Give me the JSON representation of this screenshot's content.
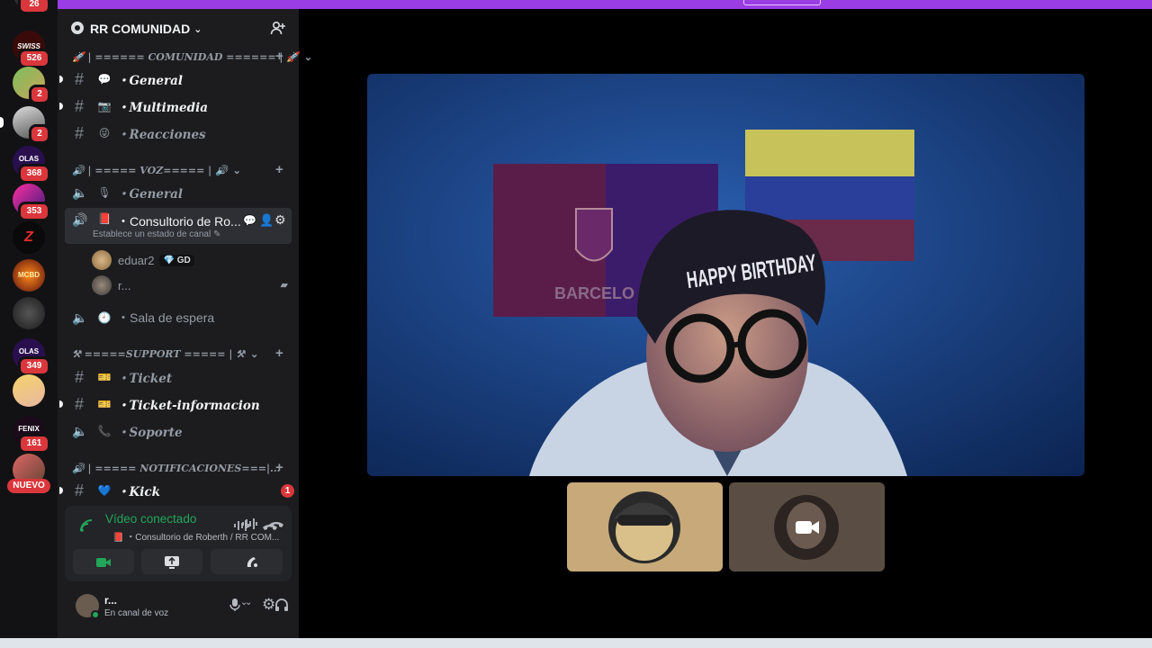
{
  "rail": {
    "top_badge": "26",
    "servers": [
      {
        "label": "SWISS",
        "badge": "526"
      },
      {
        "label": "",
        "badge": "2"
      },
      {
        "label": "",
        "badge": "2"
      },
      {
        "label": "OLAS",
        "badge": "368"
      },
      {
        "label": "",
        "badge": "353"
      },
      {
        "label": "Z",
        "badge": ""
      },
      {
        "label": "MCBD",
        "badge": ""
      },
      {
        "label": "",
        "badge": ""
      },
      {
        "label": "OLAS",
        "badge": "349"
      },
      {
        "label": "",
        "badge": ""
      },
      {
        "label": "FENIX",
        "badge": "161"
      }
    ],
    "new_label": "NUEVO"
  },
  "guild": {
    "name": "RR COMUNIDAD"
  },
  "categories": {
    "comunidad": "🚀 | ====== COMUNIDAD ====== | 🚀",
    "voz": "🔊 | ===== VOZ===== | 🔊",
    "support": "⚒ =====SUPPORT ===== | ⚒",
    "notificaciones": "🔊 | ===== NOTIFICACIONES===|..."
  },
  "channels": {
    "general": {
      "emoji": "💬",
      "name": "・General"
    },
    "multimedia": {
      "emoji": "📷",
      "name": "・Multimedia"
    },
    "reacciones": {
      "emoji": "😜",
      "name": "・Reacciones"
    },
    "voz_general": {
      "emoji": "🎙",
      "name": "・General"
    },
    "consultorio": {
      "emoji": "📕",
      "name": "・Consultorio de Ro...",
      "status_hint": "Establece un estado de canal ✎"
    },
    "sala": {
      "emoji": "🕘",
      "name": "・Sala de espera"
    },
    "ticket": {
      "emoji": "🎫",
      "name": "・Ticket"
    },
    "ticket_info": {
      "emoji": "🎫",
      "name": "・Ticket-informacion"
    },
    "soporte": {
      "emoji": "📞",
      "name": "・Soporte"
    },
    "kick": {
      "emoji": "💙",
      "name": "・Kick",
      "mentions": "1"
    }
  },
  "voice_users": [
    {
      "name": "eduar2",
      "tag": "💎 GD"
    },
    {
      "name": "r...",
      "tag": ""
    }
  ],
  "voice_panel": {
    "title": "Vídeo conectado",
    "subtitle": "📕 ・Consultorio de Roberth / RR COM..."
  },
  "user_panel": {
    "name": "r...",
    "status": "En canal de voz"
  },
  "main_video": {
    "headband_text": "HAPPY BIRTHDAY",
    "flag_text": "BARCELO"
  },
  "colors": {
    "accent_purple": "#9a3de5",
    "online_green": "#23a55a",
    "mention_red": "#da373c",
    "sidebar_bg": "#1c1c1f",
    "rail_bg": "#121214"
  }
}
